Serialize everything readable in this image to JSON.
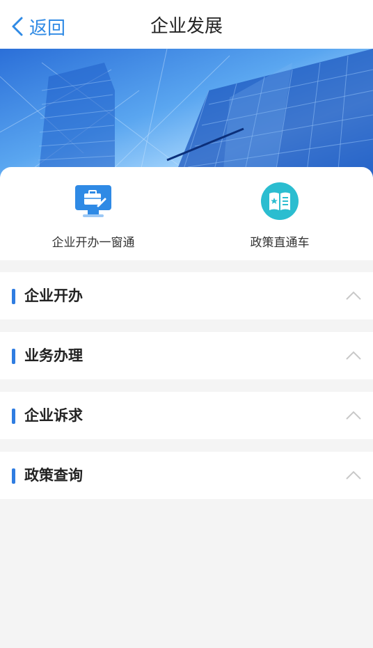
{
  "navbar": {
    "back_label": "返回",
    "title": "企业发展"
  },
  "banner": {
    "image": "city-buildings-blue"
  },
  "quick_entries": [
    {
      "label": "企业开办一窗通",
      "icon": "briefcase-monitor-icon"
    },
    {
      "label": "政策直通车",
      "icon": "open-book-icon"
    }
  ],
  "sections": [
    {
      "title": "企业开办",
      "expanded": true
    },
    {
      "title": "业务办理",
      "expanded": true
    },
    {
      "title": "企业诉求",
      "expanded": true
    },
    {
      "title": "政策查询",
      "expanded": true
    }
  ],
  "colors": {
    "accent": "#2f7de1",
    "back_link": "#2f8ae5",
    "page_bg": "#f4f4f4",
    "icon_teal": "#2bbdd0"
  }
}
